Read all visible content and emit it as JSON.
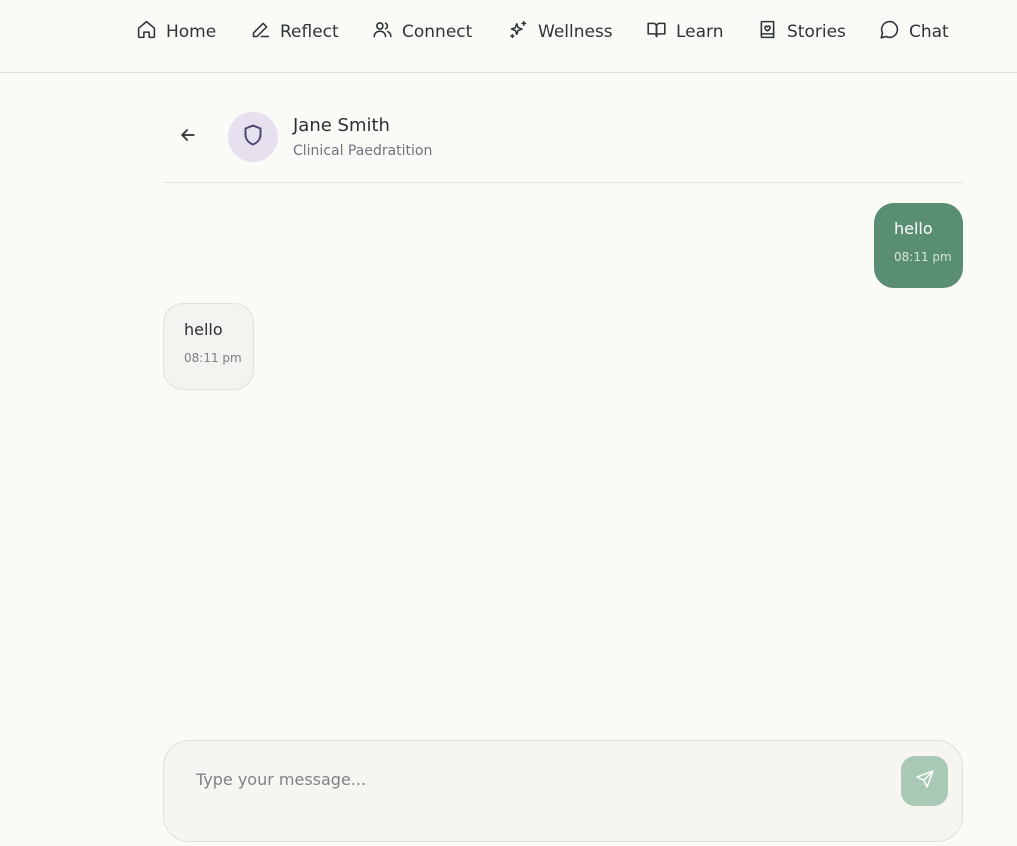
{
  "nav": {
    "items": [
      {
        "label": "Home",
        "icon": "home-icon"
      },
      {
        "label": "Reflect",
        "icon": "pencil-icon"
      },
      {
        "label": "Connect",
        "icon": "users-icon"
      },
      {
        "label": "Wellness",
        "icon": "sparkles-icon"
      },
      {
        "label": "Learn",
        "icon": "book-open-icon"
      },
      {
        "label": "Stories",
        "icon": "book-heart-icon"
      },
      {
        "label": "Chat",
        "icon": "chat-bubble-icon"
      }
    ]
  },
  "chat_header": {
    "back_icon": "arrow-left-icon",
    "avatar_icon": "shield-icon",
    "name": "Jane Smith",
    "role": "Clinical Paedratition"
  },
  "messages": [
    {
      "direction": "outgoing",
      "text": "hello",
      "time": "08:11 pm"
    },
    {
      "direction": "incoming",
      "text": "hello",
      "time": "08:11 pm"
    }
  ],
  "composer": {
    "value": "",
    "placeholder": "Type your message...",
    "send_icon": "send-icon"
  },
  "colors": {
    "background": "#fafaf7",
    "outgoing_bubble": "#5a8e72",
    "incoming_bubble": "#f4f3ef",
    "avatar_bg": "#e6e0ef",
    "avatar_icon": "#4b4770",
    "send_button": "#a9c8b5"
  }
}
